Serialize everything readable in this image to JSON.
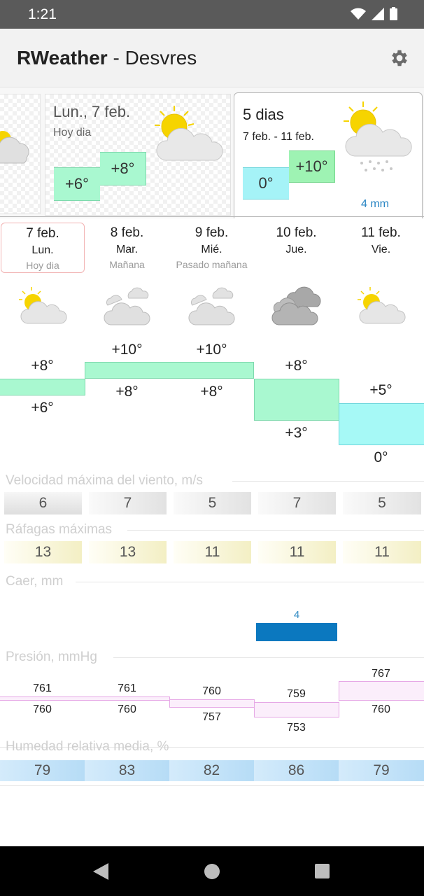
{
  "status": {
    "time": "1:21"
  },
  "app": {
    "name": "RWeather",
    "separator": " - ",
    "location": "Desvres"
  },
  "cards": {
    "today": {
      "title": "Lun., 7 feb.",
      "subtitle": "Hoy dia",
      "min": "+6°",
      "max": "+8°"
    },
    "five": {
      "title": "5 dias",
      "subtitle": "7 feb. - 11 feb.",
      "min": "0°",
      "max": "+10°",
      "rain": "4 mm"
    }
  },
  "days": [
    {
      "date": "7 feb.",
      "dow": "Lun.",
      "rel": "Hoy dia",
      "max": "+8°",
      "min": "+6°",
      "wind": "6",
      "gust": "13",
      "p_max": "761",
      "p_min": "760",
      "humidity": "79",
      "icon": "sun-cloud-icon"
    },
    {
      "date": "8 feb.",
      "dow": "Mar.",
      "rel": "Mañana",
      "max": "+10°",
      "min": "+8°",
      "wind": "7",
      "gust": "13",
      "p_max": "761",
      "p_min": "760",
      "humidity": "83",
      "icon": "cloud-icon"
    },
    {
      "date": "9 feb.",
      "dow": "Mié.",
      "rel": "Pasado mañana",
      "max": "+10°",
      "min": "+8°",
      "wind": "5",
      "gust": "11",
      "p_max": "760",
      "p_min": "757",
      "humidity": "82",
      "icon": "cloud-icon"
    },
    {
      "date": "10 feb.",
      "dow": "Jue.",
      "rel": "",
      "max": "+8°",
      "min": "+3°",
      "wind": "7",
      "gust": "11",
      "p_max": "759",
      "p_min": "753",
      "humidity": "86",
      "icon": "dark-cloud-icon"
    },
    {
      "date": "11 feb.",
      "dow": "Vie.",
      "rel": "",
      "max": "+5°",
      "min": "0°",
      "wind": "5",
      "gust": "11",
      "p_max": "767",
      "p_min": "760",
      "humidity": "79",
      "icon": "sun-cloud-icon"
    }
  ],
  "sections": {
    "wind": "Velocidad máxima del viento, m/s",
    "gust": "Ráfagas máximas",
    "rain": "Caer, mm",
    "pressure": "Presión, mmHg",
    "humidity": "Humedad relativa media, %"
  },
  "rain": {
    "day_index": 3,
    "value": "4"
  },
  "colors": {
    "warm": "#a9f8d0",
    "cold": "#a6f9f6",
    "min_box": "#a5f3f7",
    "max_box": "#9ef3b3",
    "rain": "#0b78bf",
    "pressure": "#fbeefb"
  }
}
